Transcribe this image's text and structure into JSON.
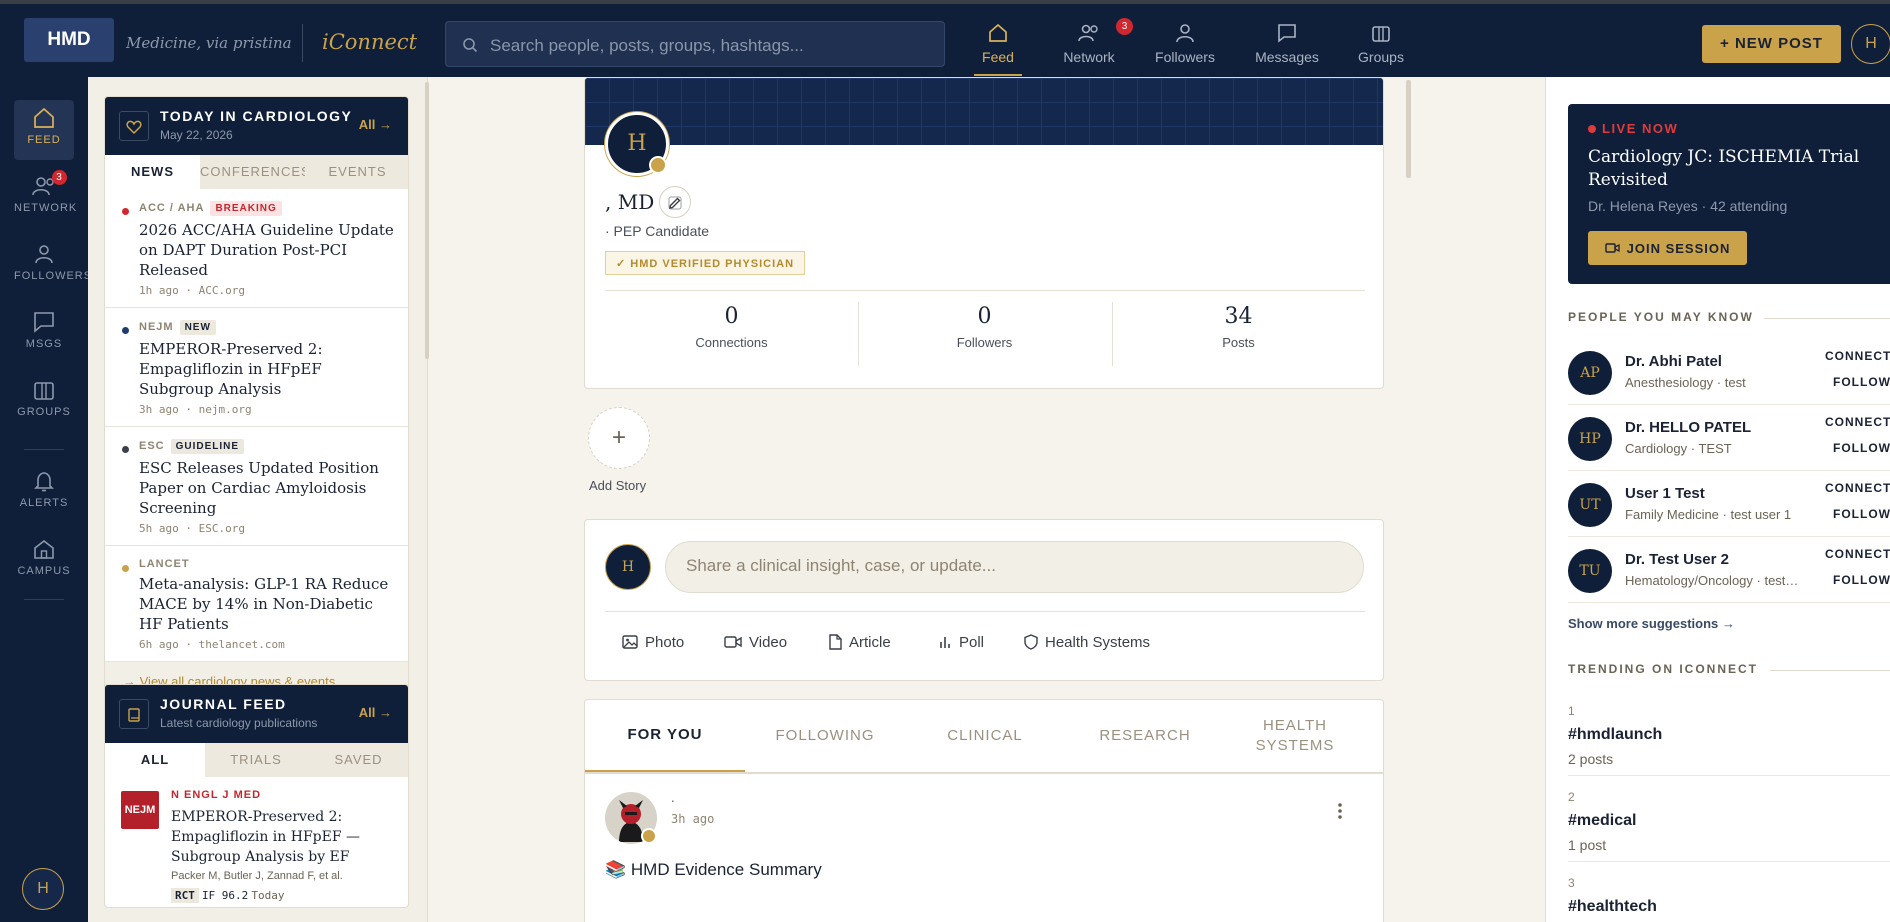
{
  "topbar": {
    "logo": "HMD",
    "tagline": "Medicine, via pristina",
    "app_name": "iConnect",
    "search_placeholder": "Search people, posts, groups, hashtags...",
    "nav": [
      {
        "label": "Feed",
        "icon": "home-icon",
        "active": true
      },
      {
        "label": "Network",
        "icon": "network-icon",
        "badge": "3"
      },
      {
        "label": "Followers",
        "icon": "person-icon"
      },
      {
        "label": "Messages",
        "icon": "message-icon"
      },
      {
        "label": "Groups",
        "icon": "groups-icon"
      }
    ],
    "new_post_label": "NEW POST",
    "avatar_initial": "H"
  },
  "rail": {
    "items": [
      {
        "label": "FEED",
        "icon": "home-icon",
        "active": true
      },
      {
        "label": "NETWORK",
        "icon": "network-icon",
        "badge": "3"
      },
      {
        "label": "FOLLOWERS",
        "icon": "person-icon"
      },
      {
        "label": "MSGS",
        "icon": "message-icon"
      },
      {
        "label": "GROUPS",
        "icon": "groups-icon"
      },
      {
        "label": "ALERTS",
        "icon": "bell-icon"
      },
      {
        "label": "CAMPUS",
        "icon": "campus-icon"
      }
    ],
    "avatar_initial": "H"
  },
  "today": {
    "title": "TODAY IN CARDIOLOGY",
    "date": "May 22, 2026",
    "all_link": "All →",
    "tabs": [
      "NEWS",
      "CONFERENCES",
      "EVENTS"
    ],
    "items": [
      {
        "source": "ACC / AHA",
        "tag": "BREAKING",
        "headline": "2026 ACC/AHA Guideline Update on DAPT Duration Post-PCI Released",
        "meta": "1h ago · ACC.org",
        "dot": "#d0282e"
      },
      {
        "source": "NEJM",
        "tag": "NEW",
        "headline": "EMPEROR-Preserved 2: Empagliflozin in HFpEF Subgroup Analysis",
        "meta": "3h ago · nejm.org",
        "dot": "#1f3a6e"
      },
      {
        "source": "ESC",
        "tag": "GUIDELINE",
        "headline": "ESC Releases Updated Position Paper on Cardiac Amyloidosis Screening",
        "meta": "5h ago · ESC.org",
        "dot": "#3a3f48"
      },
      {
        "source": "LANCET",
        "tag": "",
        "headline": "Meta-analysis: GLP-1 RA Reduce MACE by 14% in Non-Diabetic HF Patients",
        "meta": "6h ago · thelancet.com",
        "dot": "#c9a24a"
      }
    ],
    "view_all": "View all cardiology news & events"
  },
  "journal": {
    "title": "JOURNAL FEED",
    "subtitle": "Latest cardiology publications",
    "all_link": "All →",
    "tabs": [
      "ALL",
      "TRIALS",
      "SAVED"
    ],
    "item": {
      "badge": "NEJM",
      "journal": "N ENGL J MED",
      "title": "EMPEROR-Preserved 2: Empagliflozin in HFpEF — Subgroup Analysis by EF",
      "authors": "Packer M, Butler J, Zannad F, et al.",
      "type": "RCT",
      "impact": "IF 96.2",
      "when": "Today"
    }
  },
  "profile": {
    "avatar_initial": "H",
    "name": ", MD",
    "subtitle": "· PEP Candidate",
    "verified": "✓ HMD VERIFIED PHYSICIAN",
    "stats": [
      {
        "value": "0",
        "label": "Connections"
      },
      {
        "value": "0",
        "label": "Followers"
      },
      {
        "value": "34",
        "label": "Posts"
      }
    ]
  },
  "story": {
    "plus": "+",
    "label": "Add Story"
  },
  "composer": {
    "avatar_initial": "H",
    "placeholder": "Share a clinical insight, case, or update...",
    "actions": [
      {
        "label": "Photo",
        "icon": "photo-icon"
      },
      {
        "label": "Video",
        "icon": "video-icon"
      },
      {
        "label": "Article",
        "icon": "article-icon"
      },
      {
        "label": "Poll",
        "icon": "poll-icon"
      },
      {
        "label": "Health Systems",
        "icon": "shield-icon"
      }
    ]
  },
  "feed_tabs": [
    "FOR YOU",
    "FOLLOWING",
    "CLINICAL",
    "RESEARCH",
    "HEALTH SYSTEMS"
  ],
  "post": {
    "author": ".",
    "time": "3h ago",
    "text": "📚 HMD Evidence Summary"
  },
  "live": {
    "tag": "LIVE NOW",
    "title": "Cardiology JC: ISCHEMIA Trial Revisited",
    "meta": "Dr. Helena Reyes · 42 attending",
    "join_label": "JOIN SESSION"
  },
  "people": {
    "title": "PEOPLE YOU MAY KNOW",
    "items": [
      {
        "initials": "AP",
        "name": "Dr. Abhi Patel",
        "specialty": "Anesthesiology · test",
        "connect": "CONNECT",
        "follow": "FOLLOW"
      },
      {
        "initials": "HP",
        "name": "Dr. HELLO PATEL",
        "specialty": "Cardiology · TEST",
        "connect": "CONNECT",
        "follow": "FOLLOW"
      },
      {
        "initials": "UT",
        "name": "User 1 Test",
        "specialty": "Family Medicine · test user 1",
        "connect": "CONNECT",
        "follow": "FOLLOW"
      },
      {
        "initials": "TU",
        "name": "Dr. Test User 2",
        "specialty": "Hematology/Oncology · test user 2",
        "connect": "CONNECT",
        "follow": "FOLLOW"
      }
    ],
    "show_more": "Show more suggestions →"
  },
  "trending": {
    "title": "TRENDING ON ICONNECT",
    "items": [
      {
        "rank": "1",
        "tag": "#hmdlaunch",
        "count": "2 posts"
      },
      {
        "rank": "2",
        "tag": "#medical",
        "count": "1 post"
      },
      {
        "rank": "3",
        "tag": "#healthtech",
        "count": ""
      }
    ]
  },
  "colors": {
    "navy": "#0f1f3a",
    "gold": "#c9a24a",
    "breaking": "#d0282e"
  }
}
